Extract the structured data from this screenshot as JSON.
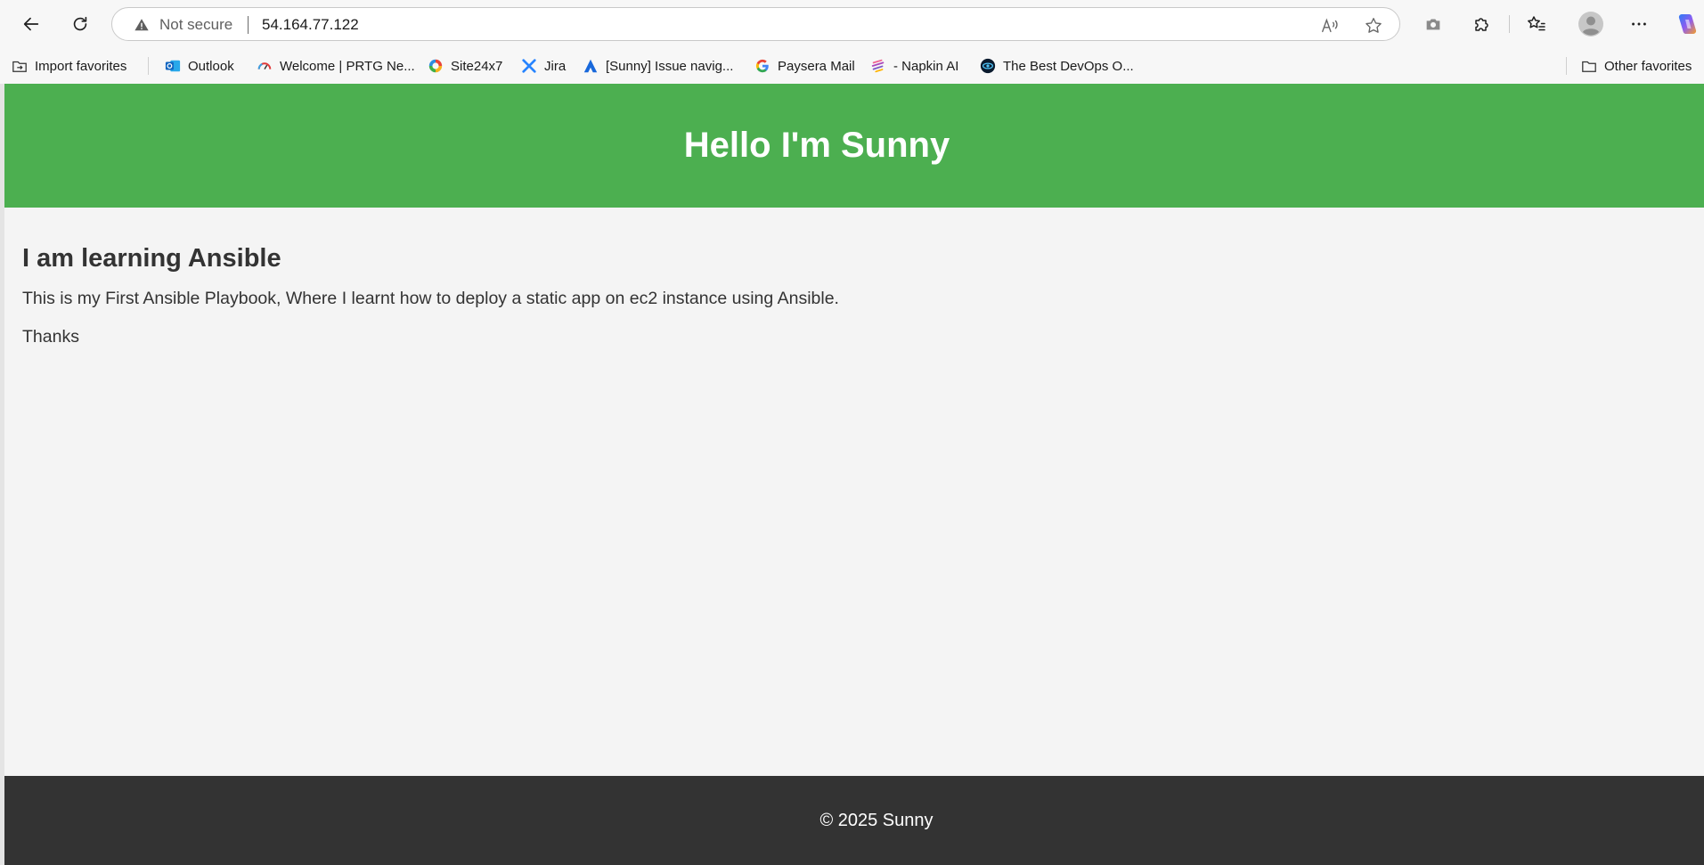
{
  "browser": {
    "address_bar": {
      "security_label": "Not secure",
      "url": "54.164.77.122"
    },
    "favorites": [
      {
        "label": "Import favorites",
        "icon": "import-icon"
      },
      {
        "label": "Outlook",
        "icon": "outlook-icon"
      },
      {
        "label": "Welcome | PRTG Ne...",
        "icon": "prtg-icon"
      },
      {
        "label": "Site24x7",
        "icon": "site24x7-icon"
      },
      {
        "label": "Jira",
        "icon": "jira-icon"
      },
      {
        "label": "[Sunny] Issue navig...",
        "icon": "atlassian-icon"
      },
      {
        "label": "Paysera Mail",
        "icon": "google-icon"
      },
      {
        "label": "- Napkin AI",
        "icon": "napkin-icon"
      },
      {
        "label": "The Best DevOps O...",
        "icon": "devops-icon"
      }
    ],
    "other_favorites": "Other favorites"
  },
  "page": {
    "header_title": "Hello I'm Sunny",
    "heading": "I am learning Ansible",
    "paragraphs": [
      "This is my First Ansible Playbook, Where I learnt how to deploy a static app on ec2 instance using Ansible.",
      "Thanks"
    ],
    "footer": "© 2025 Sunny"
  },
  "colors": {
    "header_bg": "#4caf50",
    "footer_bg": "#333333",
    "content_bg": "#f4f4f4"
  }
}
